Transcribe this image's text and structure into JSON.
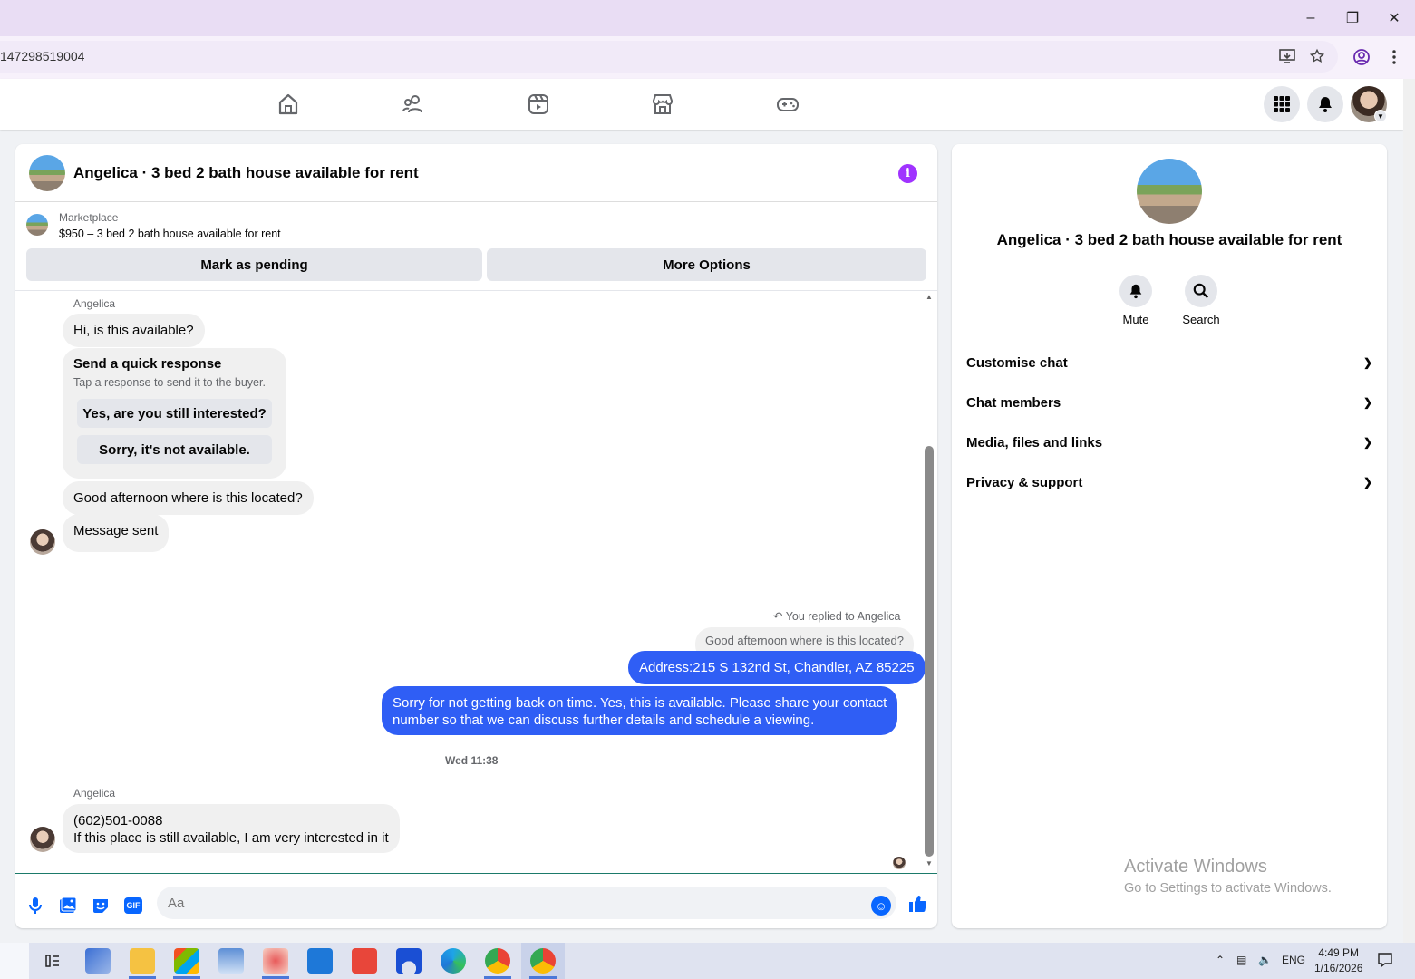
{
  "browser": {
    "address_text": "147298519004"
  },
  "chat": {
    "title": "Angelica · 3 bed 2 bath house available for rent",
    "marketplace_label": "Marketplace",
    "listing_text": "$950 – 3 bed 2 bath house available for rent",
    "mark_pending_label": "Mark as pending",
    "more_options_label": "More Options",
    "messages": {
      "sender_1": "Angelica",
      "m1": "Hi, is this available?",
      "quick_title": "Send a quick response",
      "quick_sub": "Tap a response to send it to the buyer.",
      "quick_opt_1": "Yes, are you still interested?",
      "quick_opt_2": "Sorry, it's not available.",
      "m2": "Good afternoon where is this located?",
      "m3": "Message sent",
      "reply_note": "You replied to Angelica",
      "reply_quote": "Good afternoon where is this located?",
      "out1": "Address:215 S 132nd St, Chandler, AZ 85225",
      "out2_line1": "Sorry for not getting back on time. Yes, this is available. Please share your contact",
      "out2_line2": "number so that we can discuss further details and schedule a viewing.",
      "timestamp": "Wed 11:38",
      "sender_2": "Angelica",
      "m4_line1": "(602)501-0088",
      "m4_line2": "If this place is still available, I am very interested in it"
    },
    "composer_placeholder": "Aa",
    "gif_label": "GIF"
  },
  "info_panel": {
    "title": "Angelica · 3 bed 2 bath house available for rent",
    "mute_label": "Mute",
    "search_label": "Search",
    "rows": [
      "Customise chat",
      "Chat members",
      "Media, files and links",
      "Privacy & support"
    ]
  },
  "watermark": {
    "line1": "Activate Windows",
    "line2": "Go to Settings to activate Windows."
  },
  "taskbar": {
    "lang": "ENG",
    "time": "4:49 PM",
    "date": "1/16/2026"
  },
  "colors": {
    "accent": "#0866ff",
    "outgoing_bubble": "#2f5ef5",
    "info_icon": "#a033ff"
  }
}
